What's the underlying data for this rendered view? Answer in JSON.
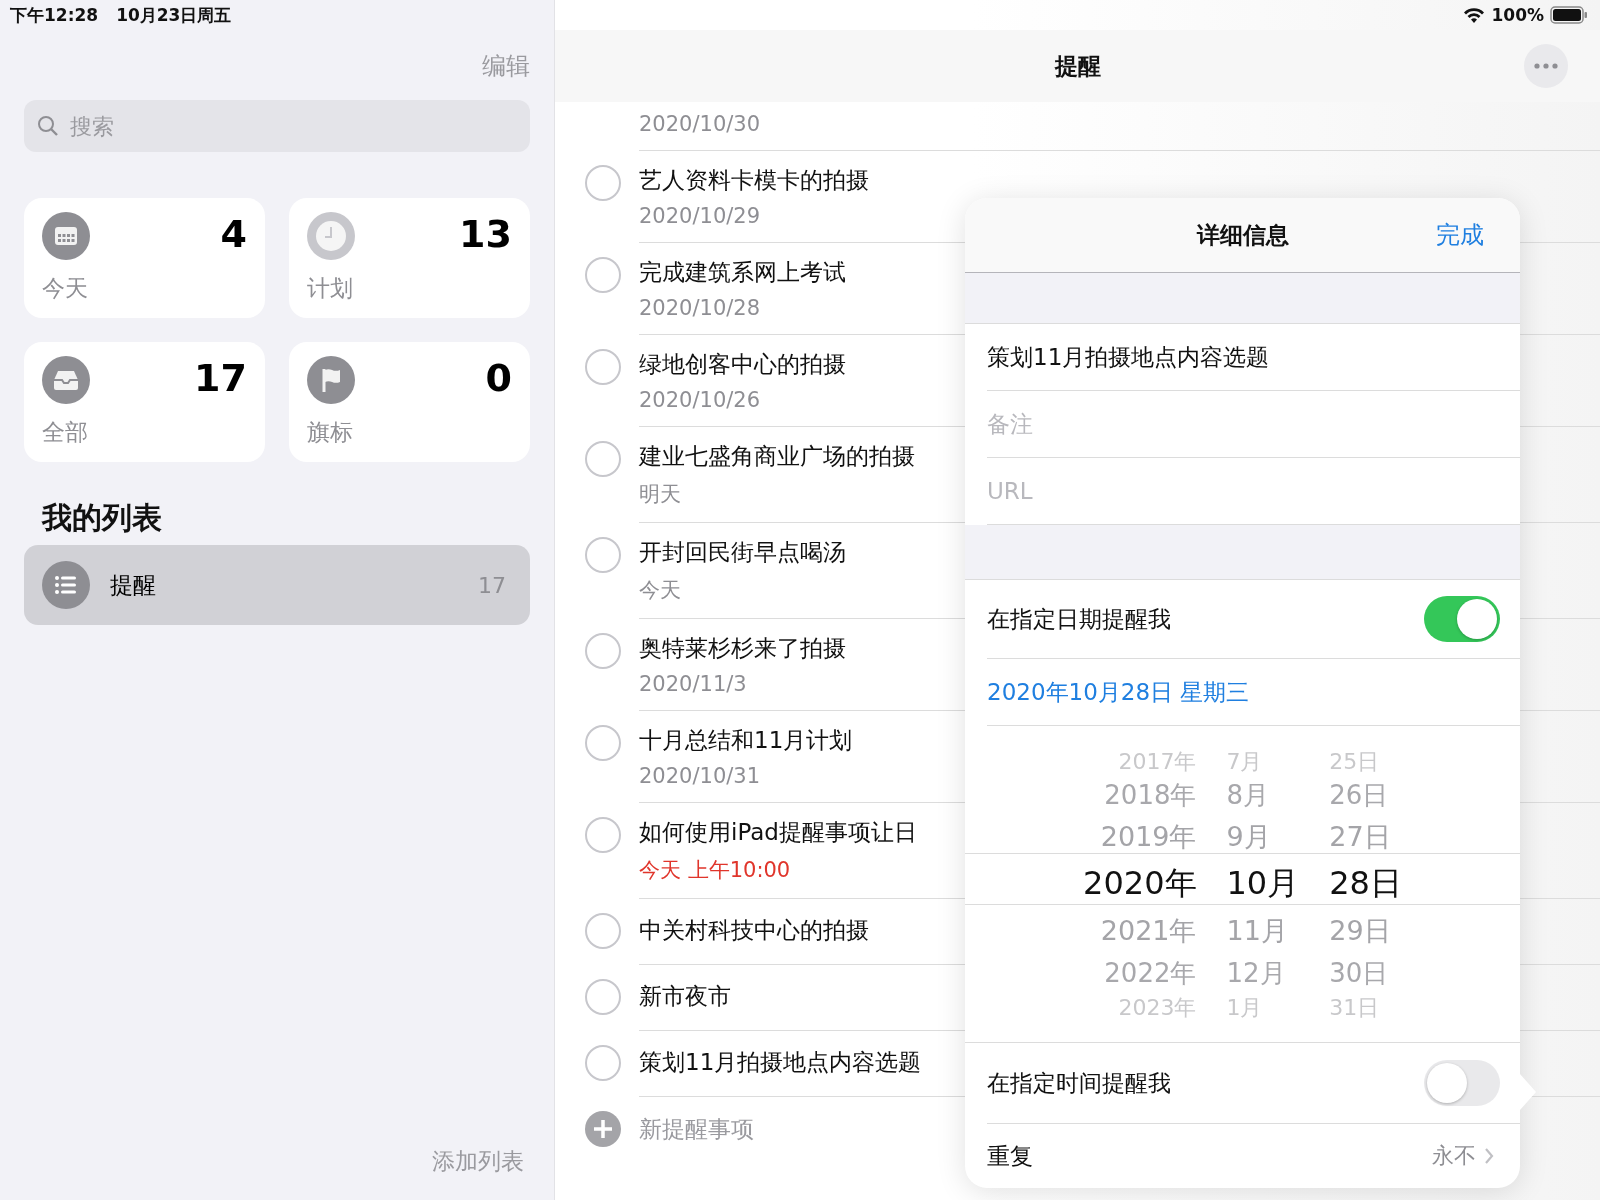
{
  "status_bar": {
    "time": "下午12:28",
    "date": "10月23日周五",
    "battery": "100%"
  },
  "sidebar": {
    "edit": "编辑",
    "search": {
      "placeholder": "搜索"
    },
    "smart_lists": [
      {
        "kind": "today",
        "label": "今天",
        "count": "4"
      },
      {
        "kind": "scheduled",
        "label": "计划",
        "count": "13"
      },
      {
        "kind": "all",
        "label": "全部",
        "count": "17"
      },
      {
        "kind": "flagged",
        "label": "旗标",
        "count": "0"
      }
    ],
    "section_title": "我的列表",
    "lists": [
      {
        "name": "提醒",
        "count": "17",
        "selected": true
      }
    ],
    "add_list": "添加列表"
  },
  "main": {
    "title": "提醒",
    "reminders": [
      {
        "date": "2020/10/30",
        "overdue": false
      },
      {
        "title": "艺人资料卡模卡的拍摄",
        "date": "2020/10/29",
        "overdue": false
      },
      {
        "title": "完成建筑系网上考试",
        "date": "2020/10/28",
        "overdue": false
      },
      {
        "title": "绿地创客中心的拍摄",
        "date": "2020/10/26",
        "overdue": false
      },
      {
        "title": "建业七盛角商业广场的拍摄",
        "date": "明天",
        "overdue": false
      },
      {
        "title": "开封回民街早点喝汤",
        "date": "今天",
        "overdue": false
      },
      {
        "title": "奥特莱杉杉来了拍摄",
        "date": "2020/11/3",
        "overdue": false
      },
      {
        "title": "十月总结和11月计划",
        "date": "2020/10/31",
        "overdue": false
      },
      {
        "title": "如何使用iPad提醒事项让日",
        "date": "今天 上午10:00",
        "overdue": true
      },
      {
        "title": "中关村科技中心的拍摄"
      },
      {
        "title": "新市夜市"
      },
      {
        "title": "策划11月拍摄地点内容选题"
      }
    ],
    "new_reminder": "新提醒事项"
  },
  "details": {
    "title": "详细信息",
    "done": "完成",
    "fields": [
      {
        "value": "策划11月拍摄地点内容选题"
      },
      {
        "placeholder": "备注"
      },
      {
        "placeholder": "URL"
      }
    ],
    "remind_on_date": {
      "label": "在指定日期提醒我",
      "on": true
    },
    "selected_date": "2020年10月28日 星期三",
    "picker": {
      "columns": [
        {
          "items": [
            {
              "text": "2017年",
              "selected": false
            },
            {
              "text": "2018年",
              "selected": false
            },
            {
              "text": "2019年",
              "selected": false
            },
            {
              "text": "2020年",
              "selected": true
            },
            {
              "text": "2021年",
              "selected": false
            },
            {
              "text": "2022年",
              "selected": false
            },
            {
              "text": "2023年",
              "selected": false
            }
          ]
        },
        {
          "items": [
            {
              "text": "7月",
              "selected": false
            },
            {
              "text": "8月",
              "selected": false
            },
            {
              "text": "9月",
              "selected": false
            },
            {
              "text": "10月",
              "selected": true
            },
            {
              "text": "11月",
              "selected": false
            },
            {
              "text": "12月",
              "selected": false
            },
            {
              "text": "1月",
              "selected": false
            }
          ]
        },
        {
          "items": [
            {
              "text": "25日",
              "selected": false
            },
            {
              "text": "26日",
              "selected": false
            },
            {
              "text": "27日",
              "selected": false
            },
            {
              "text": "28日",
              "selected": true
            },
            {
              "text": "29日",
              "selected": false
            },
            {
              "text": "30日",
              "selected": false
            },
            {
              "text": "31日",
              "selected": false
            }
          ]
        }
      ]
    },
    "remind_at_time": {
      "label": "在指定时间提醒我",
      "on": false
    },
    "repeat": {
      "label": "重复",
      "value": "永不"
    }
  }
}
